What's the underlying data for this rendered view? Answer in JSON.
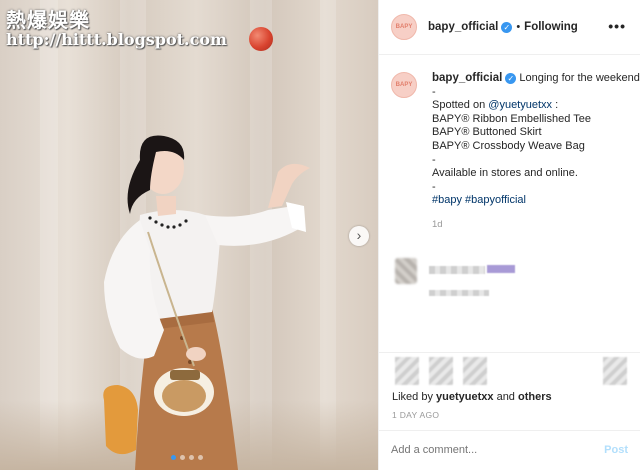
{
  "watermark": {
    "site_name": "熱爆娛樂",
    "url": "http://hittt.blogspot.com"
  },
  "post": {
    "account": {
      "username": "bapy_official",
      "avatar_text": "BAPY",
      "verified": true
    },
    "header": {
      "separator": "•",
      "follow_status": "Following",
      "more_icon": "•••"
    },
    "caption": {
      "text": "Longing for the weekend like...",
      "dash1": "-",
      "spotted_prefix": "Spotted on ",
      "mention": "@yuetyuetxx",
      "spotted_suffix": " :",
      "item1": "BAPY® Ribbon Embellished Tee",
      "item2": "BAPY® Buttoned Skirt",
      "item3": "BAPY® Crossbody Weave Bag",
      "dash2": "-",
      "availability": "Available in stores and online.",
      "dash3": "-",
      "hashtag1": "#bapy",
      "hashtag2": "#bapyofficial",
      "age": "1d"
    },
    "likes": {
      "prefix": "Liked by ",
      "user": "yuetyuetxx",
      "middle": " and ",
      "others": "others"
    },
    "date": "1 DAY AGO",
    "comment": {
      "placeholder": "Add a comment...",
      "post_label": "Post"
    },
    "carousel": {
      "next_icon": "›",
      "total_slides": 4,
      "active_slide": 1
    }
  },
  "colors": {
    "link": "#003569",
    "verified": "#3897f0",
    "post_button": "#b2dffc",
    "avatar_bg": "#f7cfc6"
  }
}
